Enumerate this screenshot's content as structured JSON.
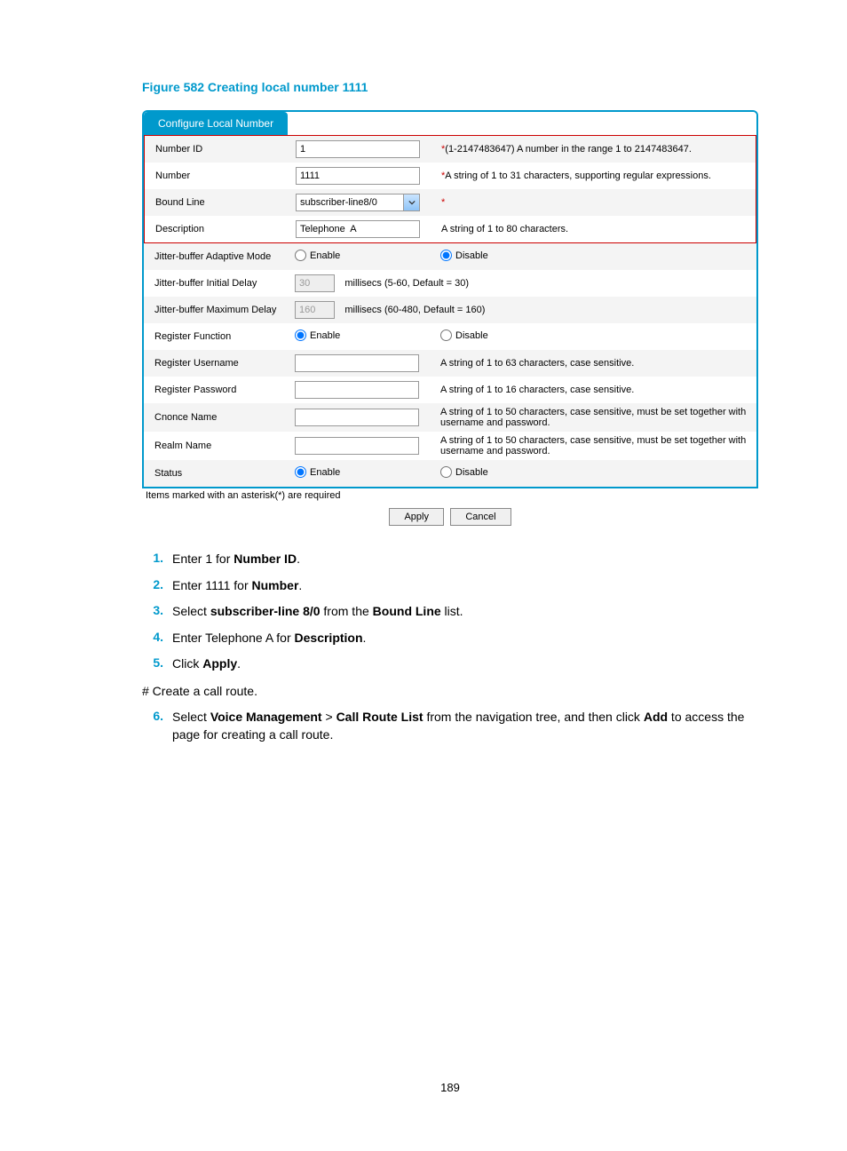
{
  "figure_title": "Figure 582 Creating local number 1111",
  "tab_label": "Configure Local Number",
  "rows": {
    "number_id": {
      "label": "Number ID",
      "value": "1",
      "hint_prefix": "*",
      "hint": "(1-2147483647) A number in the range 1 to 2147483647."
    },
    "number": {
      "label": "Number",
      "value": "1111",
      "hint_prefix": "*",
      "hint": "A string of 1 to 31 characters, supporting regular expressions."
    },
    "bound_line": {
      "label": "Bound Line",
      "value": "subscriber-line8/0",
      "hint_prefix": "*",
      "hint": ""
    },
    "description": {
      "label": "Description",
      "value": "Telephone  A",
      "hint": "A string of 1 to 80 characters."
    },
    "jitter_mode": {
      "label": "Jitter-buffer Adaptive Mode",
      "enable": "Enable",
      "disable": "Disable",
      "selected": "disable"
    },
    "jitter_initial": {
      "label": "Jitter-buffer Initial Delay",
      "value": "30",
      "hint": "millisecs (5-60, Default = 30)"
    },
    "jitter_max": {
      "label": "Jitter-buffer Maximum Delay",
      "value": "160",
      "hint": "millisecs (60-480, Default = 160)"
    },
    "reg_function": {
      "label": "Register Function",
      "enable": "Enable",
      "disable": "Disable",
      "selected": "enable"
    },
    "reg_username": {
      "label": "Register Username",
      "value": "",
      "hint": "A string of 1 to 63 characters, case sensitive."
    },
    "reg_password": {
      "label": "Register Password",
      "value": "",
      "hint": "A string of 1 to 16 characters, case sensitive."
    },
    "cnonce": {
      "label": "Cnonce Name",
      "value": "",
      "hint": "A string of 1 to 50 characters, case sensitive, must be set together with username and password."
    },
    "realm": {
      "label": "Realm Name",
      "value": "",
      "hint": "A string of 1 to 50 characters, case sensitive, must be set together with username and password."
    },
    "status": {
      "label": "Status",
      "enable": "Enable",
      "disable": "Disable",
      "selected": "enable"
    }
  },
  "note": "Items marked with an asterisk(*) are required",
  "buttons": {
    "apply": "Apply",
    "cancel": "Cancel"
  },
  "steps": [
    {
      "num": "1.",
      "html": "Enter 1 for <b>Number ID</b>."
    },
    {
      "num": "2.",
      "html": "Enter 1111 for <b>Number</b>."
    },
    {
      "num": "3.",
      "html": "Select <b>subscriber-line 8/0</b> from the <b>Bound Line</b> list."
    },
    {
      "num": "4.",
      "html": "Enter Telephone A for <b>Description</b>."
    },
    {
      "num": "5.",
      "html": "Click <b>Apply</b>."
    }
  ],
  "para": "# Create a call route.",
  "step6": {
    "num": "6.",
    "html": "Select <b>Voice Management</b> > <b>Call Route List</b> from the navigation tree, and then click <b>Add</b> to access the page for creating a call route."
  },
  "page_num": "189"
}
